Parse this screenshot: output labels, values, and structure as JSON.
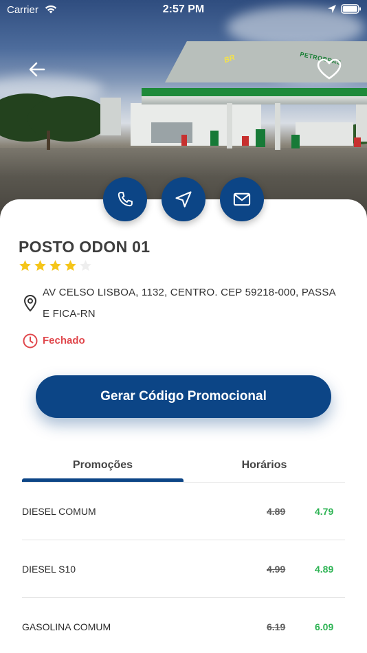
{
  "status_bar": {
    "carrier": "Carrier",
    "time": "2:57 PM"
  },
  "hero": {
    "sign_brand": "BR",
    "sign_name": "PETROBRAS"
  },
  "actions": {
    "phone_icon": "phone-icon",
    "navigate_icon": "navigation-arrow-icon",
    "email_icon": "mail-icon"
  },
  "station": {
    "name": "POSTO ODON 01",
    "rating": 4,
    "rating_max": 5,
    "address": "AV CELSO LISBOA, 1132, CENTRO. CEP 59218-000, PASSA E FICA-RN",
    "status": "Fechado"
  },
  "promo_button": {
    "label": "Gerar Código Promocional"
  },
  "tabs": [
    {
      "label": "Promoções",
      "active": true
    },
    {
      "label": "Horários",
      "active": false
    }
  ],
  "prices": [
    {
      "fuel": "DIESEL COMUM",
      "old_price": "4.89",
      "new_price": "4.79"
    },
    {
      "fuel": "DIESEL S10",
      "old_price": "4.99",
      "new_price": "4.89"
    },
    {
      "fuel": "GASOLINA COMUM",
      "old_price": "6.19",
      "new_price": "6.09"
    }
  ],
  "colors": {
    "primary": "#0c4586",
    "discount_green": "#2fb455",
    "closed_red": "#e0474c",
    "star_yellow": "#f5c518",
    "star_empty": "#eeeeee"
  }
}
